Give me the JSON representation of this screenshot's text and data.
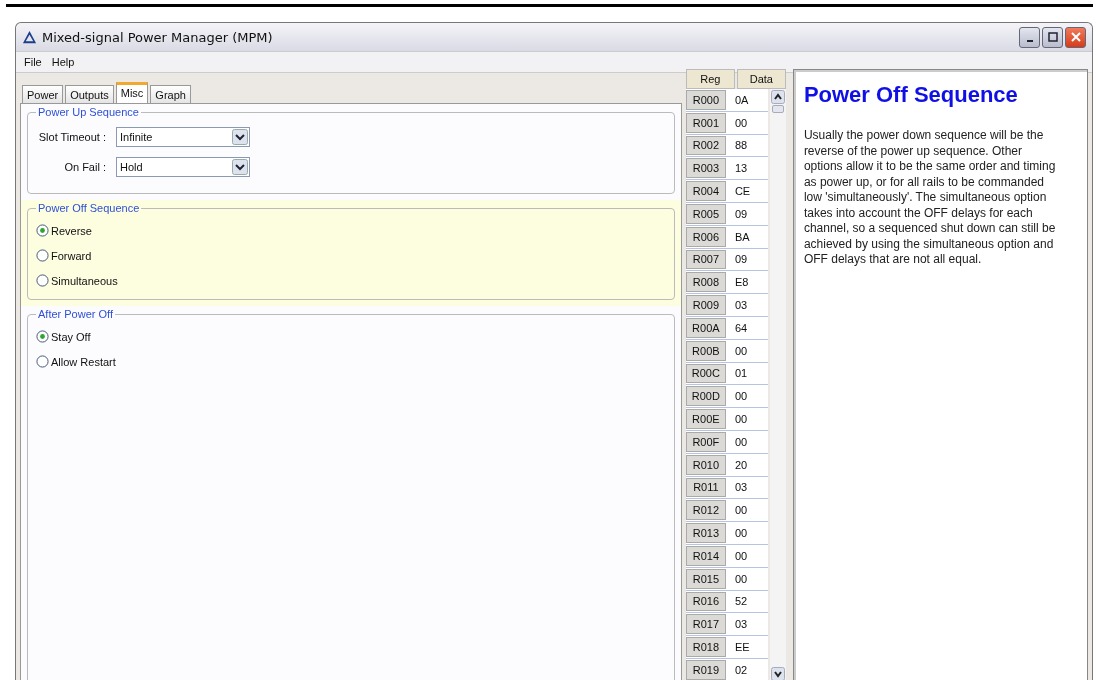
{
  "window": {
    "title": "Mixed-signal Power Manager (MPM)"
  },
  "menu": [
    "File",
    "Help"
  ],
  "tabs": [
    {
      "label": "Power",
      "selected": false
    },
    {
      "label": "Outputs",
      "selected": false
    },
    {
      "label": "Misc",
      "selected": true
    },
    {
      "label": "Graph",
      "selected": false
    }
  ],
  "power_up_sequence": {
    "title": "Power Up Sequence",
    "highlighted": false,
    "fields": [
      {
        "label": "Slot Timeout :",
        "value": "Infinite"
      },
      {
        "label": "On Fail :",
        "value": "Hold"
      }
    ]
  },
  "option_groups": [
    {
      "title": "Power Off Sequence",
      "highlighted": true,
      "options": [
        {
          "label": "Reverse",
          "selected": true
        },
        {
          "label": "Forward",
          "selected": false
        },
        {
          "label": "Simultaneous",
          "selected": false
        }
      ]
    },
    {
      "title": "After Power Off",
      "highlighted": false,
      "options": [
        {
          "label": "Stay Off",
          "selected": true
        },
        {
          "label": "Allow Restart",
          "selected": false
        }
      ]
    }
  ],
  "register_table": {
    "columns": [
      "Reg",
      "Data"
    ],
    "rows": [
      {
        "reg": "R000",
        "data": "0A"
      },
      {
        "reg": "R001",
        "data": "00"
      },
      {
        "reg": "R002",
        "data": "88"
      },
      {
        "reg": "R003",
        "data": "13"
      },
      {
        "reg": "R004",
        "data": "CE"
      },
      {
        "reg": "R005",
        "data": "09"
      },
      {
        "reg": "R006",
        "data": "BA"
      },
      {
        "reg": "R007",
        "data": "09"
      },
      {
        "reg": "R008",
        "data": "E8"
      },
      {
        "reg": "R009",
        "data": "03"
      },
      {
        "reg": "R00A",
        "data": "64"
      },
      {
        "reg": "R00B",
        "data": "00"
      },
      {
        "reg": "R00C",
        "data": "01"
      },
      {
        "reg": "R00D",
        "data": "00"
      },
      {
        "reg": "R00E",
        "data": "00"
      },
      {
        "reg": "R00F",
        "data": "00"
      },
      {
        "reg": "R010",
        "data": "20"
      },
      {
        "reg": "R011",
        "data": "03"
      },
      {
        "reg": "R012",
        "data": "00"
      },
      {
        "reg": "R013",
        "data": "00"
      },
      {
        "reg": "R014",
        "data": "00"
      },
      {
        "reg": "R015",
        "data": "00"
      },
      {
        "reg": "R016",
        "data": "52"
      },
      {
        "reg": "R017",
        "data": "03"
      },
      {
        "reg": "R018",
        "data": "EE"
      },
      {
        "reg": "R019",
        "data": "02"
      }
    ]
  },
  "help": {
    "title": "Power Off Sequence",
    "text": "Usually the power down sequence will be the reverse of the power up sequence. Other options allow it to be the same order and timing as power up, or for all rails to be commanded low 'simultaneously'. The simultaneous option takes into account the OFF delays for each channel, so a sequenced shut down can still be achieved by using the simultaneous option and OFF delays that are not all equal."
  }
}
